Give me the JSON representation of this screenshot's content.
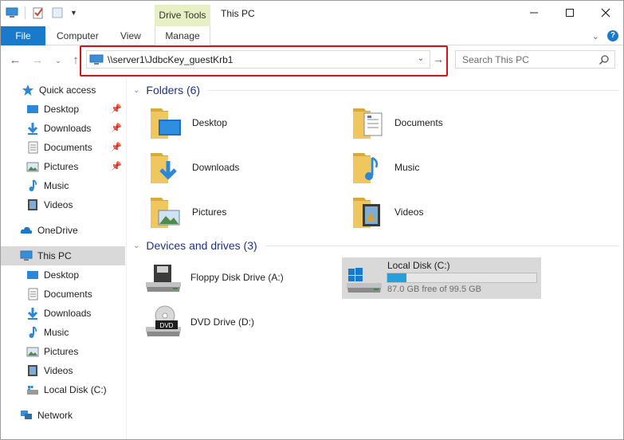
{
  "window": {
    "title": "This PC",
    "context_tab": "Drive Tools",
    "minimize_icon": "minimize-icon",
    "maximize_icon": "maximize-icon",
    "close_icon": "close-icon"
  },
  "ribbon": {
    "file": "File",
    "tabs": [
      "Computer",
      "View",
      "Manage"
    ]
  },
  "navigation": {
    "address_value": "\\\\server1\\JdbcKey_guestKrb1",
    "search_placeholder": "Search This PC"
  },
  "sidebar": {
    "quick_access": "Quick access",
    "quick_items": [
      "Desktop",
      "Downloads",
      "Documents",
      "Pictures",
      "Music",
      "Videos"
    ],
    "onedrive": "OneDrive",
    "this_pc": "This PC",
    "pc_items": [
      "Desktop",
      "Documents",
      "Downloads",
      "Music",
      "Pictures",
      "Videos",
      "Local Disk (C:)"
    ],
    "network": "Network"
  },
  "main": {
    "folders_header": "Folders (6)",
    "folders": [
      "Desktop",
      "Documents",
      "Downloads",
      "Music",
      "Pictures",
      "Videos"
    ],
    "devices_header": "Devices and drives (3)",
    "floppy": "Floppy Disk Drive (A:)",
    "dvd": "DVD Drive (D:)",
    "dvd_badge": "DVD",
    "local_disk": {
      "name": "Local Disk (C:)",
      "free_text": "87.0 GB free of 99.5 GB",
      "used_fraction": 0.126
    }
  },
  "colors": {
    "accent": "#1979ca",
    "highlight_border": "#d3151b",
    "drive_tools_tab": "#e6f0c4",
    "group_header": "#1e3287"
  }
}
